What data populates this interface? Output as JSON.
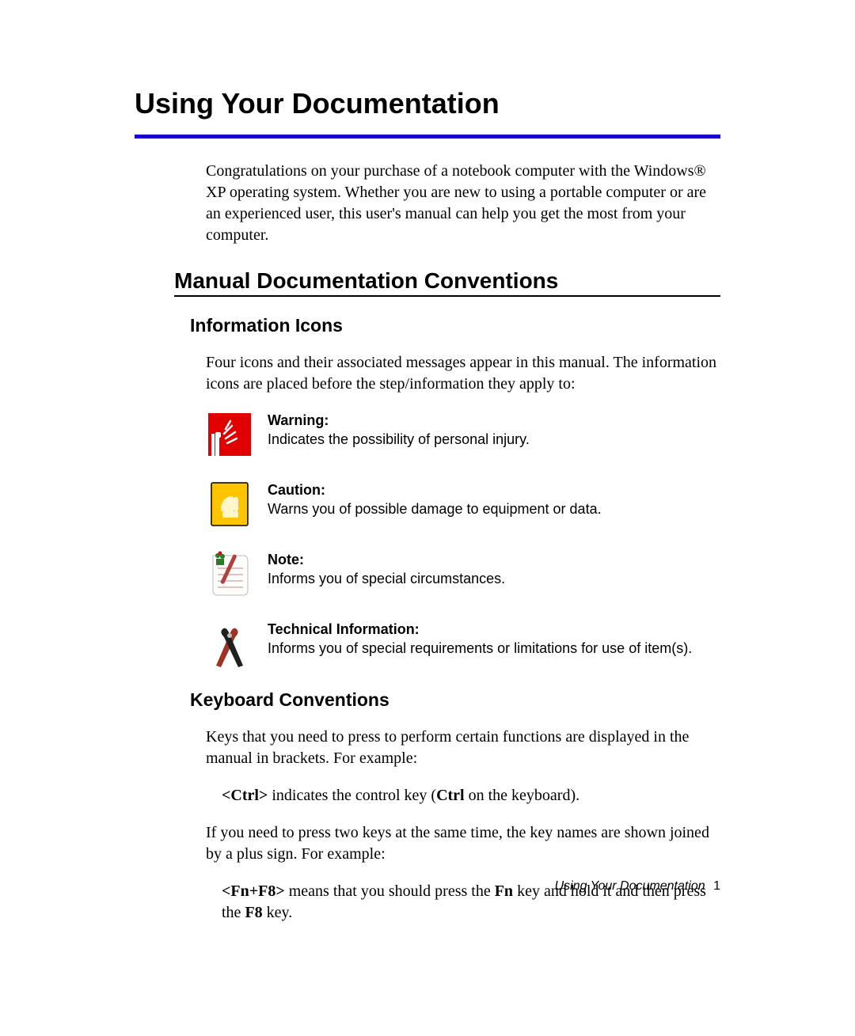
{
  "title": "Using Your Documentation",
  "intro": "Congratulations on your purchase of a notebook computer with the Windows® XP operating system. Whether you are new to using a portable computer or are an experienced user, this user's manual can help you get the most from your computer.",
  "section_heading": "Manual Documentation Conventions",
  "info_icons": {
    "heading": "Information Icons",
    "intro": "Four icons and their associated messages appear in this manual. The information icons are placed before the step/information they apply to:",
    "items": [
      {
        "label": "Warning:",
        "desc": "Indicates the possibility of personal injury."
      },
      {
        "label": "Caution:",
        "desc": "Warns you of possible damage to equipment or data."
      },
      {
        "label": "Note:",
        "desc": "Informs you of special circumstances."
      },
      {
        "label": "Technical Information:",
        "desc": "Informs you of special requirements or limitations for use of item(s)."
      }
    ]
  },
  "keyboard": {
    "heading": "Keyboard Conventions",
    "p1": "Keys that you need to press to perform certain functions are displayed in the manual in brackets. For example:",
    "p2_key": "<Ctrl>",
    "p2_mid": " indicates the control key (",
    "p2_bold": "Ctrl",
    "p2_end": " on the keyboard).",
    "p3": "If you need to press two keys at the same time, the key names are shown joined by a plus sign. For example:",
    "p4_key": "<Fn+F8>",
    "p4_a": " means that you should press the ",
    "p4_b1": "Fn",
    "p4_b": " key and hold it and then press the ",
    "p4_b2": "F8",
    "p4_c": " key."
  },
  "footer": {
    "label": "Using Your Documentation",
    "page": "1"
  }
}
